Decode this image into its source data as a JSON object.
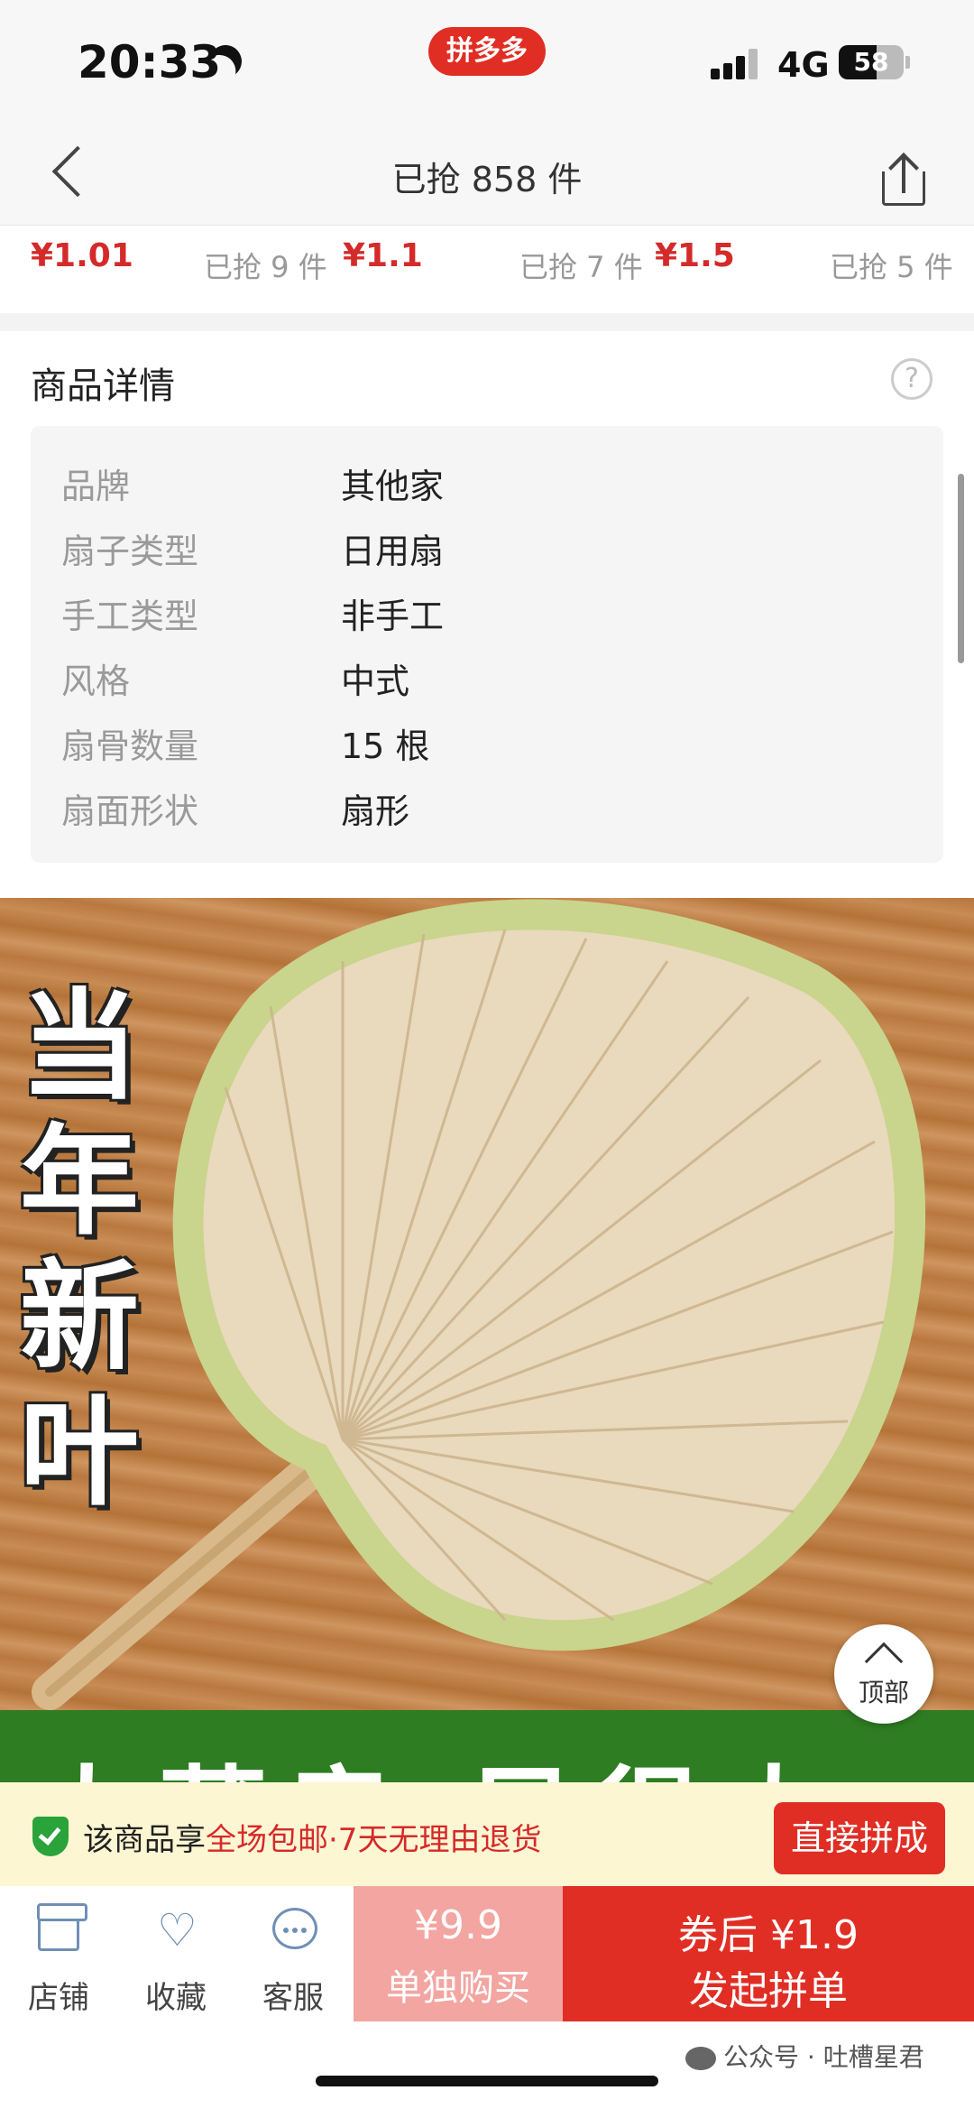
{
  "status_bar": {
    "time": "20:33",
    "app_badge": "拼多多",
    "network": "4G",
    "battery": "58",
    "battery_level": 0.58
  },
  "nav": {
    "title": "已抢 858 件"
  },
  "price_strip": [
    {
      "price": "¥1.01",
      "sold": "已抢 9 件"
    },
    {
      "price": "¥1.1",
      "sold": "已抢 7 件"
    },
    {
      "price": "¥1.5",
      "sold": "已抢 5 件"
    }
  ],
  "details": {
    "title": "商品详情",
    "rows": [
      {
        "key": "品牌",
        "value": "其他家"
      },
      {
        "key": "扇子类型",
        "value": "日用扇"
      },
      {
        "key": "手工类型",
        "value": "非手工"
      },
      {
        "key": "风格",
        "value": "中式"
      },
      {
        "key": "扇骨数量",
        "value": "15 根"
      },
      {
        "key": "扇面形状",
        "value": "扇形"
      }
    ]
  },
  "image": {
    "promo_lines": [
      "当",
      "年",
      "新",
      "叶"
    ],
    "banner": "大蒲扇 风很大",
    "top_button": "顶部"
  },
  "guarantee": {
    "prefix": "该商品享",
    "highlight": "全场包邮·7天无理由退货",
    "button": "直接拼成"
  },
  "actions": {
    "store": "店铺",
    "favorite": "收藏",
    "service": "客服",
    "single_price": "¥9.9",
    "single_label": "单独购买",
    "group_price": "券后 ¥1.9",
    "group_label": "发起拼单"
  },
  "watermark": "公众号 · 吐槽星君",
  "colors": {
    "brand_red": "#e02e24",
    "price_red": "#d52a2a",
    "banner_green": "#2e7d22",
    "guarantee_bg": "#fdf6d3"
  }
}
